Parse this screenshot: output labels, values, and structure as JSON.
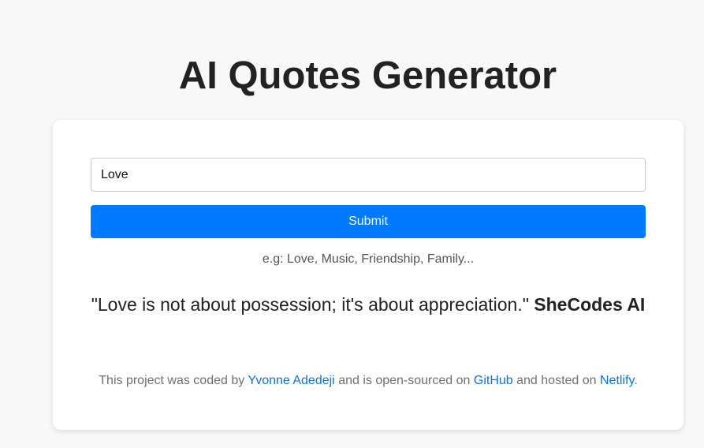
{
  "header": {
    "title": "AI Quotes Generator"
  },
  "form": {
    "input_value": "Love",
    "submit_label": "Submit",
    "hint": "e.g: Love, Music, Friendship, Family..."
  },
  "quote": {
    "text": "\"Love is not about possession; it's about appreciation.\"",
    "author": "SheCodes AI"
  },
  "footer": {
    "prefix": "This project was coded by",
    "author_link": "Yvonne Adedeji",
    "middle1": "and is open-sourced on",
    "github_link": "GitHub",
    "middle2": "and hosted on",
    "netlify_link": "Netlify",
    "suffix": "."
  },
  "colors": {
    "accent": "#007bff",
    "link": "#0a74d8",
    "background": "#f8f8f8",
    "card": "#ffffff"
  }
}
